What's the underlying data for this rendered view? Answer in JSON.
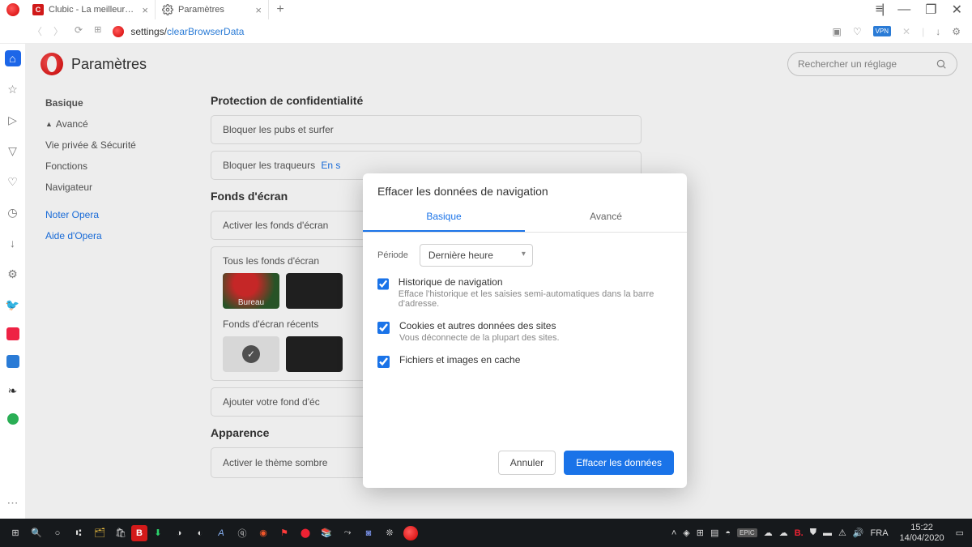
{
  "tabs": [
    {
      "title": "Clubic - La meilleure sourc",
      "favicon_bg": "#d01919",
      "favicon_txt": "C"
    },
    {
      "title": "Paramètres",
      "favicon_gear": true
    }
  ],
  "window_controls": {
    "menu": "≡",
    "min": "—",
    "max": "▢",
    "close": "✕"
  },
  "address": {
    "prefix": "settings/",
    "suffix": "clearBrowserData"
  },
  "leftrail": {
    "icons": [
      "home",
      "star",
      "play",
      "tri",
      "heart",
      "clock",
      "download",
      "gear",
      "twitter",
      "square-red",
      "square-blue",
      "leaf",
      "dot-green"
    ]
  },
  "settings": {
    "title": "Paramètres",
    "search_placeholder": "Rechercher un réglage",
    "sidenav": {
      "basique": "Basique",
      "avance": "Avancé",
      "vie_privee": "Vie privée & Sécurité",
      "fonctions": "Fonctions",
      "navigateur": "Navigateur",
      "noter": "Noter Opera",
      "aide": "Aide d'Opera"
    },
    "sections": {
      "privacy_title": "Protection de confidentialité",
      "block_ads": "Bloquer les pubs et surfer",
      "block_trackers": "Bloquer les traqueurs",
      "learn_more": "En s",
      "wallpapers_title": "Fonds d'écran",
      "enable_wp": "Activer les fonds d'écran",
      "all_wp": "Tous les fonds d'écran",
      "wp_bureau": "Bureau",
      "recent_wp": "Fonds d'écran récents",
      "add_wp": "Ajouter votre fond d'éc",
      "appearance_title": "Apparence",
      "dark_theme": "Activer le thème sombre"
    }
  },
  "modal": {
    "title": "Effacer les données de navigation",
    "tab_basic": "Basique",
    "tab_advanced": "Avancé",
    "period_label": "Période",
    "period_value": "Dernière heure",
    "items": [
      {
        "title": "Historique de navigation",
        "desc": "Efface l'historique et les saisies semi-automatiques dans la barre d'adresse."
      },
      {
        "title": "Cookies et autres données des sites",
        "desc": "Vous déconnecte de la plupart des sites."
      },
      {
        "title": "Fichiers et images en cache",
        "desc": ""
      }
    ],
    "cancel": "Annuler",
    "confirm": "Effacer les données"
  },
  "taskbar": {
    "lang": "FRA",
    "time": "15:22",
    "date": "14/04/2020"
  }
}
